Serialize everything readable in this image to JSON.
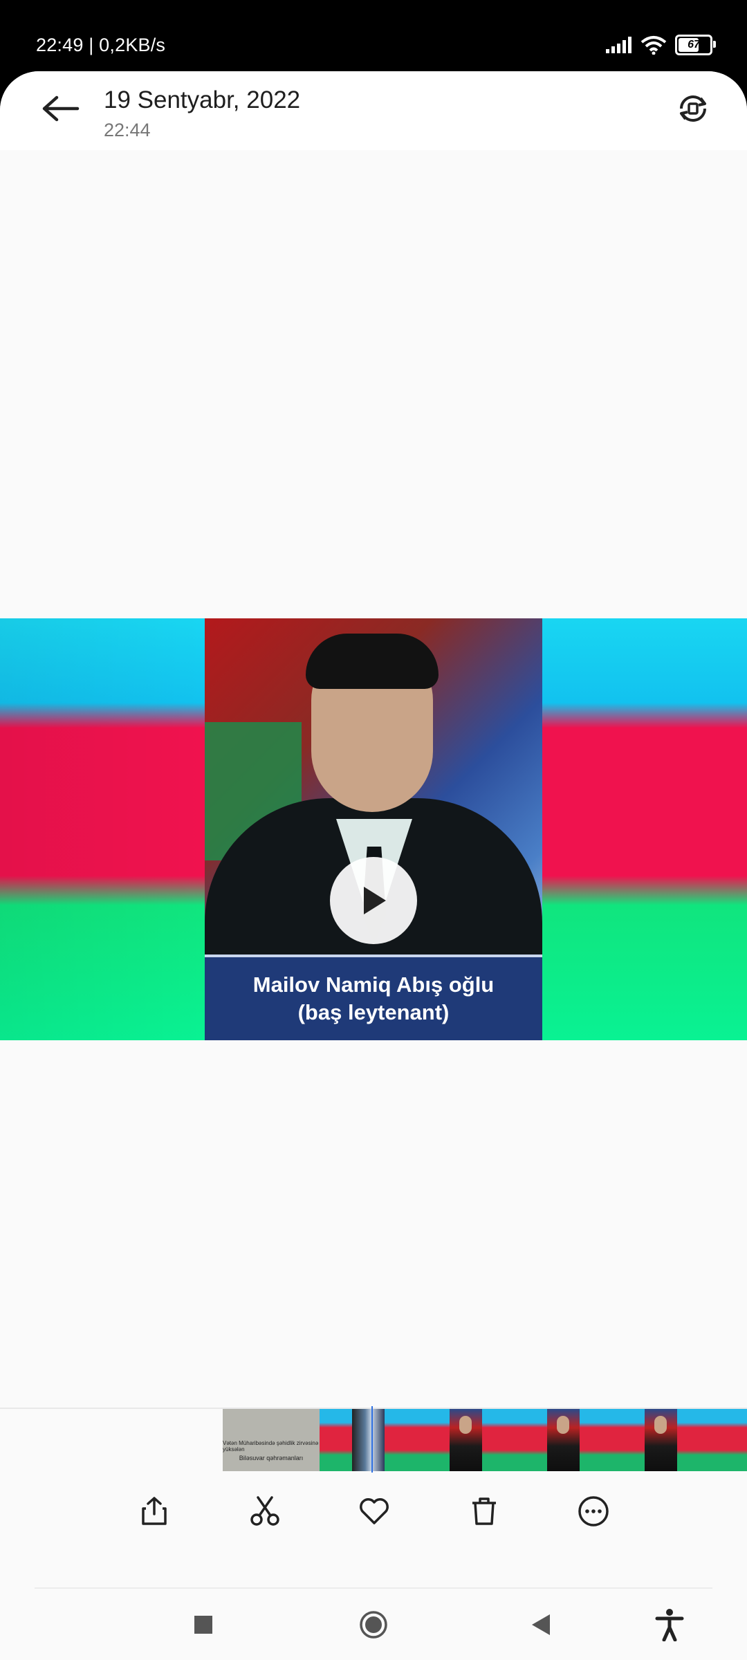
{
  "status_bar": {
    "time_speed": "22:49 | 0,2KB/s",
    "battery": "67"
  },
  "header": {
    "title": "19 Sentyabr, 2022",
    "subtitle": "22:44",
    "icons": [
      "back-arrow-icon",
      "rotate-icon"
    ]
  },
  "video": {
    "caption_line1": "Mailov Namiq Abış oğlu",
    "caption_line2": "(baş leytenant)",
    "play_icon": "play-icon",
    "flag_colors": [
      "#19d6f2",
      "#f0124e",
      "#10e57e"
    ]
  },
  "filmstrip": {
    "first_thumb_line1": "Vətən Müharibəsində şəhidlik zirvəsinə yüksələn",
    "first_thumb_line2": "Biləsuvar qəhrəmanları"
  },
  "toolbar": {
    "icons": [
      "share-icon",
      "cut-icon",
      "favorite-icon",
      "delete-icon",
      "more-icon"
    ]
  },
  "navbar": {
    "icons": [
      "recents-icon",
      "home-icon",
      "back-icon",
      "accessibility-icon"
    ]
  }
}
